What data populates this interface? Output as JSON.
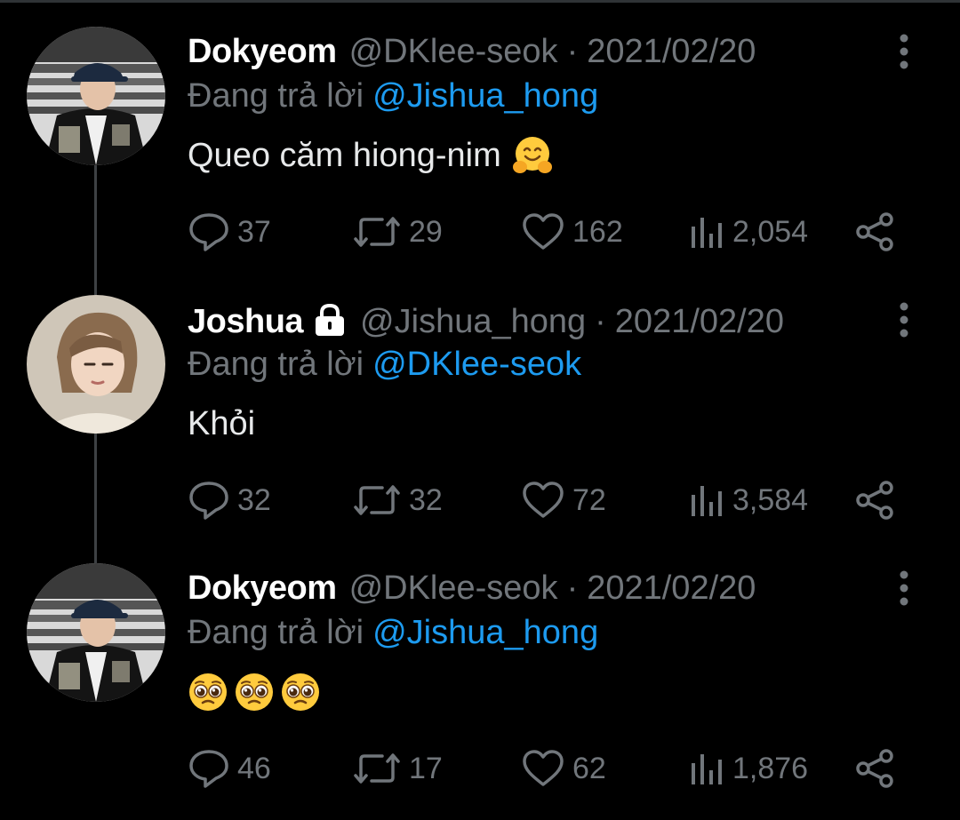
{
  "colors": {
    "background": "#000000",
    "text": "#e7e9ea",
    "muted": "#71767b",
    "link": "#1d9bf0"
  },
  "tweets": [
    {
      "name": "Dokyeom",
      "verified_lock": false,
      "handle": "@DKlee-seok",
      "separator": "·",
      "date": "2021/02/20",
      "reply_label": "Đang trả lời",
      "reply_to": "@Jishua_hong",
      "text": "Queo căm hiong-nim",
      "emoji": [
        "hugging-face"
      ],
      "stats": {
        "replies": "37",
        "retweets": "29",
        "likes": "162",
        "views": "2,054"
      }
    },
    {
      "name": "Joshua",
      "verified_lock": true,
      "handle": "@Jishua_hong",
      "separator": "·",
      "date": "2021/02/20",
      "reply_label": "Đang trả lời",
      "reply_to": "@DKlee-seok",
      "text": "Khỏi",
      "emoji": [],
      "stats": {
        "replies": "32",
        "retweets": "32",
        "likes": "72",
        "views": "3,584"
      }
    },
    {
      "name": "Dokyeom",
      "verified_lock": false,
      "handle": "@DKlee-seok",
      "separator": "·",
      "date": "2021/02/20",
      "reply_label": "Đang trả lời",
      "reply_to": "@Jishua_hong",
      "text": "",
      "emoji": [
        "pleading-face",
        "pleading-face",
        "pleading-face"
      ],
      "stats": {
        "replies": "46",
        "retweets": "17",
        "likes": "62",
        "views": "1,876"
      }
    }
  ]
}
